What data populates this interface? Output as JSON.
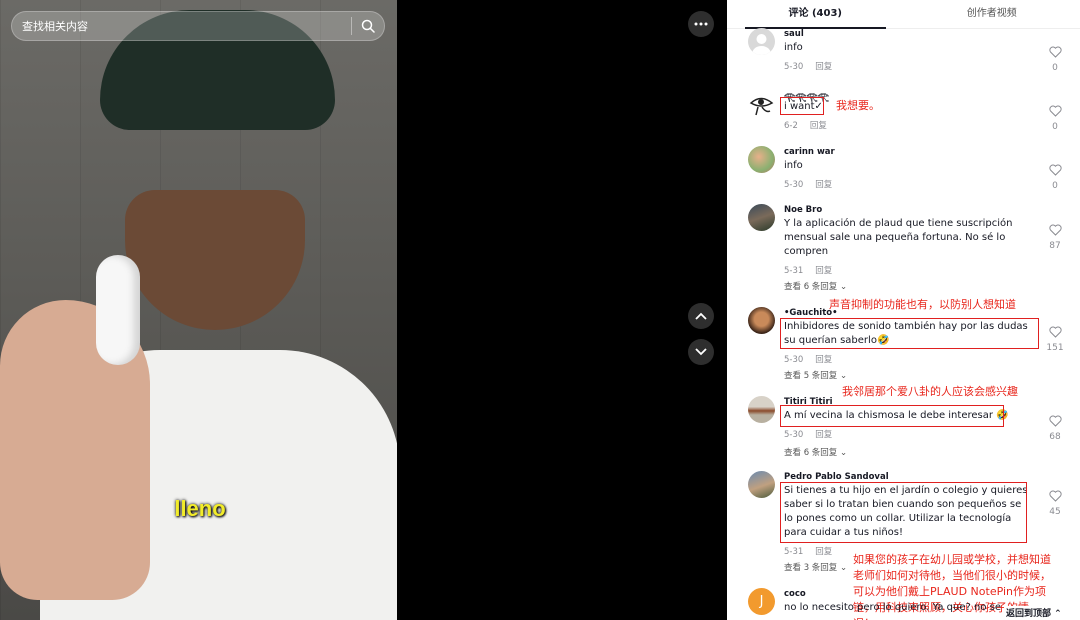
{
  "search": {
    "placeholder": "查找相关内容"
  },
  "video": {
    "caption": "lleno"
  },
  "tabs": [
    {
      "label": "评论 (403)",
      "active": true
    },
    {
      "label": "创作者视频",
      "active": false
    }
  ],
  "comments": [
    {
      "user": "saul",
      "text": "info",
      "date": "5-30",
      "reply": "回复",
      "likes": "0"
    },
    {
      "user": "𓂀𓂀𓂀𓂀",
      "text": "i want✓",
      "date": "6-2",
      "reply": "回复",
      "likes": "0",
      "annotation": "我想要。"
    },
    {
      "user": "carinn war",
      "text": "info",
      "date": "5-30",
      "reply": "回复",
      "likes": "0"
    },
    {
      "user": "Noe Bro",
      "text": "Y la aplicación de plaud que tiene suscripción mensual sale una pequeña fortuna. No sé lo compren",
      "date": "5-31",
      "reply": "回复",
      "likes": "87",
      "more": "查看 6 条回复"
    },
    {
      "user": "•Gauchito•",
      "text": "Inhibidores de sonido también hay por las dudas su querían saberlo🤣",
      "date": "5-30",
      "reply": "回复",
      "likes": "151",
      "more": "查看 5 条回复",
      "annotation": "声音抑制的功能也有，以防别人想知道"
    },
    {
      "user": "Titiri Titiri",
      "text": "A mí vecina la chismosa le debe interesar 🤣",
      "date": "5-30",
      "reply": "回复",
      "likes": "68",
      "more": "查看 6 条回复",
      "annotation": "我邻居那个爱八卦的人应该会感兴趣"
    },
    {
      "user": "Pedro Pablo Sandoval",
      "text": "Si tienes a tu hijo en el jardín o colegio y quieres saber si lo tratan bien cuando son pequeños se lo pones como un collar. Utilizar la tecnología para cuidar a tus niños!",
      "date": "5-31",
      "reply": "回复",
      "likes": "45",
      "more": "查看 3 条回复",
      "annotation": "如果您的孩子在幼儿园或学校，并想知道\n老师们如何对待他，当他们很小的时候，\n可以为他们戴上PLAUD NotePin作为项\n链，用科技来照顾，关心你孩子的情\n况！"
    },
    {
      "user": "coco",
      "text": "no lo necesito pero lo quiero. Ya que? no se",
      "date": "",
      "reply": "",
      "likes": ""
    }
  ],
  "back_to_top": "返回到顶部"
}
